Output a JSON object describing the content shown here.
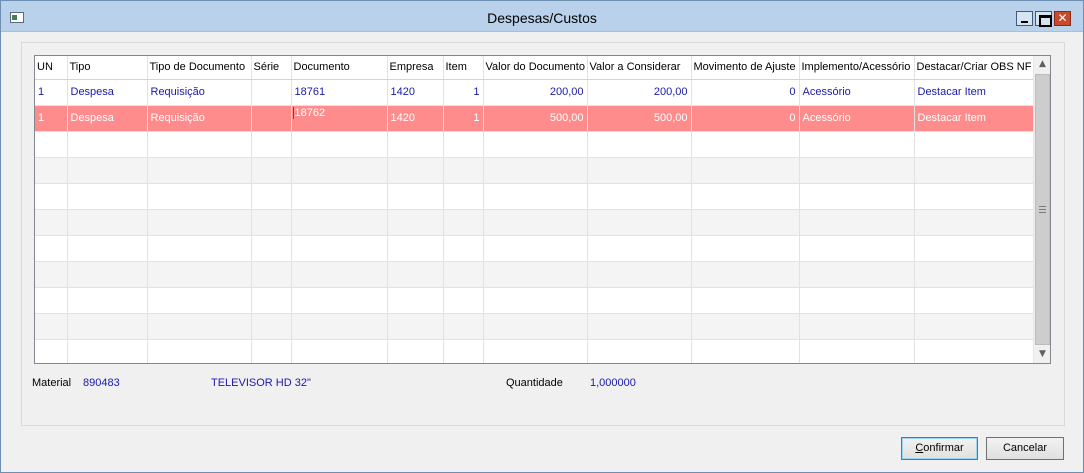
{
  "window": {
    "title": "Despesas/Custos"
  },
  "grid": {
    "columns": [
      "UN",
      "Tipo",
      "Tipo de Documento",
      "Série",
      "Documento",
      "Empresa",
      "Item",
      "Valor do Documento",
      "Valor a Considerar",
      "Movimento de Ajuste",
      "Implemento/Acessório",
      "Destacar/Criar OBS NF"
    ],
    "rows": [
      [
        "1",
        "Despesa",
        "Requisição",
        "",
        "18761",
        "1420",
        "1",
        "200,00",
        "200,00",
        "0",
        "Acessório",
        "Destacar Item"
      ],
      [
        "1",
        "Despesa",
        "Requisição",
        "",
        "18762",
        "1420",
        "1",
        "500,00",
        "500,00",
        "0",
        "Acessório",
        "Destacar Item"
      ]
    ]
  },
  "footer": {
    "material_label": "Material",
    "material_code": "890483",
    "material_desc": "TELEVISOR HD 32\"",
    "quantidade_label": "Quantidade",
    "quantidade_value": "1,000000"
  },
  "buttons": {
    "confirm_first": "C",
    "confirm_rest": "onfirmar",
    "cancel": "Cancelar"
  },
  "colors": {
    "selected_row": "#ff8c8c",
    "value_text": "#1a1aa6",
    "titlebar": "#b9d1ea"
  },
  "icons": {
    "window": "app-window-icon",
    "minimize": "minimize-icon",
    "maximize": "maximize-icon",
    "close": "close-icon"
  }
}
